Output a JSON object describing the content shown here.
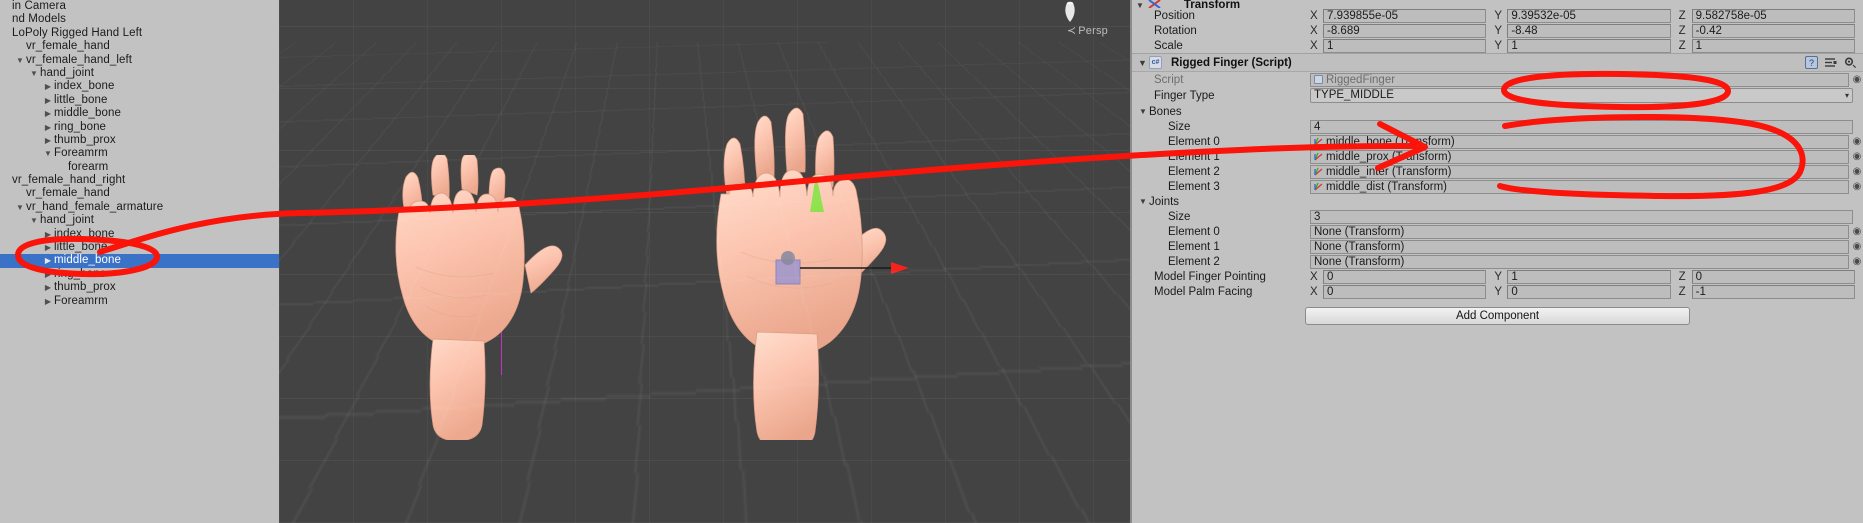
{
  "hierarchy": {
    "rows": [
      {
        "label": "in Camera",
        "indent": 0,
        "twisty": "none",
        "selected": false
      },
      {
        "label": "nd Models",
        "indent": 0,
        "twisty": "none",
        "selected": false
      },
      {
        "label": "LoPoly Rigged Hand Left",
        "indent": 0,
        "twisty": "none",
        "selected": false
      },
      {
        "label": "vr_female_hand",
        "indent": 1,
        "twisty": "none",
        "selected": false
      },
      {
        "label": "vr_female_hand_left",
        "indent": 1,
        "twisty": "expanded",
        "selected": false
      },
      {
        "label": "hand_joint",
        "indent": 2,
        "twisty": "expanded",
        "selected": false
      },
      {
        "label": "index_bone",
        "indent": 3,
        "twisty": "collapsed",
        "selected": false
      },
      {
        "label": "little_bone",
        "indent": 3,
        "twisty": "collapsed",
        "selected": false
      },
      {
        "label": "middle_bone",
        "indent": 3,
        "twisty": "collapsed",
        "selected": false
      },
      {
        "label": "ring_bone",
        "indent": 3,
        "twisty": "collapsed",
        "selected": false
      },
      {
        "label": "thumb_prox",
        "indent": 3,
        "twisty": "collapsed",
        "selected": false
      },
      {
        "label": "Foreamrm",
        "indent": 3,
        "twisty": "expanded",
        "selected": false
      },
      {
        "label": "forearm",
        "indent": 4,
        "twisty": "none",
        "selected": false
      },
      {
        "label": "vr_female_hand_right",
        "indent": 0,
        "twisty": "none",
        "selected": false
      },
      {
        "label": "vr_female_hand",
        "indent": 1,
        "twisty": "none",
        "selected": false
      },
      {
        "label": "vr_hand_female_armature",
        "indent": 1,
        "twisty": "expanded",
        "selected": false
      },
      {
        "label": "hand_joint",
        "indent": 2,
        "twisty": "expanded",
        "selected": false
      },
      {
        "label": "index_bone",
        "indent": 3,
        "twisty": "collapsed",
        "selected": false
      },
      {
        "label": "little_bone",
        "indent": 3,
        "twisty": "collapsed",
        "selected": false
      },
      {
        "label": "middle_bone",
        "indent": 3,
        "twisty": "collapsed",
        "selected": true
      },
      {
        "label": "ring_bone",
        "indent": 3,
        "twisty": "collapsed",
        "selected": false
      },
      {
        "label": "thumb_prox",
        "indent": 3,
        "twisty": "collapsed",
        "selected": false
      },
      {
        "label": "Foreamrm",
        "indent": 3,
        "twisty": "collapsed",
        "selected": false
      }
    ],
    "selection_color": "#3a72c8"
  },
  "scene": {
    "projection_label": "Persp",
    "gizmo_icon": "view-cone-gizmo",
    "background_color": "#434343"
  },
  "inspector": {
    "transform": {
      "title": "Transform",
      "rows": [
        {
          "label": "Position",
          "x": "7.939855e-05",
          "y": "9.39532e-05",
          "z": "9.582758e-05"
        },
        {
          "label": "Rotation",
          "x": "-8.689",
          "y": "-8.48",
          "z": "-0.42"
        },
        {
          "label": "Scale",
          "x": "1",
          "y": "1",
          "z": "1"
        }
      ],
      "axis_labels": {
        "x": "X",
        "y": "Y",
        "z": "Z"
      }
    },
    "rigged_finger": {
      "title": "Rigged Finger (Script)",
      "badge": "c#",
      "header_icons": [
        "help-icon",
        "preset-icon",
        "gear-icon"
      ],
      "script_label": "Script",
      "script_value": "RiggedFinger",
      "finger_type_label": "Finger Type",
      "finger_type_value": "TYPE_MIDDLE",
      "bones": {
        "label": "Bones",
        "size_label": "Size",
        "size_value": "4",
        "elements": [
          {
            "label": "Element 0",
            "value": "middle_bone (Transform)"
          },
          {
            "label": "Element 1",
            "value": "middle_prox (Transform)"
          },
          {
            "label": "Element 2",
            "value": "middle_inter (Transform)"
          },
          {
            "label": "Element 3",
            "value": "middle_dist (Transform)"
          }
        ]
      },
      "joints": {
        "label": "Joints",
        "size_label": "Size",
        "size_value": "3",
        "elements": [
          {
            "label": "Element 0",
            "value": "None (Transform)"
          },
          {
            "label": "Element 1",
            "value": "None (Transform)"
          },
          {
            "label": "Element 2",
            "value": "None (Transform)"
          }
        ]
      },
      "model_finger_pointing": {
        "label": "Model Finger Pointing",
        "x": "0",
        "y": "1",
        "z": "0"
      },
      "model_palm_facing": {
        "label": "Model Palm Facing",
        "x": "0",
        "y": "0",
        "z": "-1"
      }
    },
    "add_component_label": "Add Component"
  },
  "annotations": {
    "color": "#fb1409",
    "marks": [
      "ellipse-around-middle-bone-hierarchy",
      "long-arrow-to-bones-element-list",
      "ellipse-around-finger-type-value",
      "ellipse-around-bones-elements"
    ]
  }
}
